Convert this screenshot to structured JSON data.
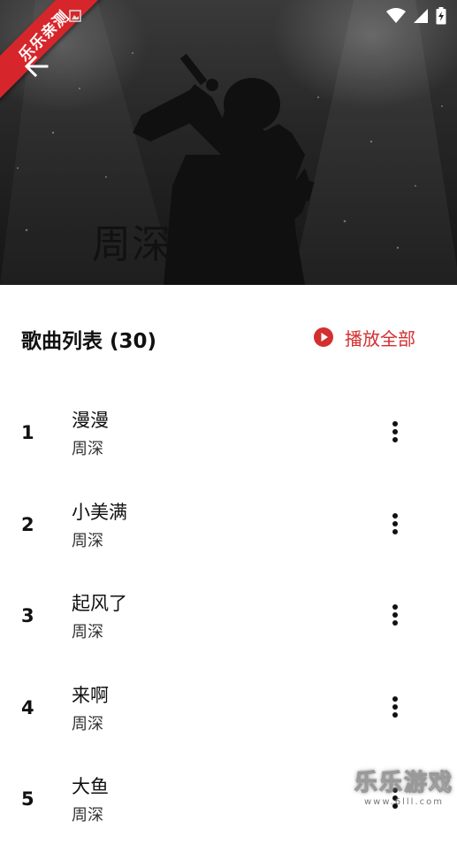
{
  "hero": {
    "artist_name": "周深",
    "ribbon_text": "乐乐亲测",
    "back_icon": "arrow-left-icon"
  },
  "status_bar": {
    "icons": [
      "wifi-icon",
      "signal-icon",
      "battery-charging-icon"
    ]
  },
  "song_list": {
    "title": "歌曲列表 (30)",
    "play_all_label": "播放全部",
    "play_all_icon": "play-circle-icon",
    "accent_color": "#d32f2f",
    "songs": [
      {
        "index": "1",
        "title": "漫漫",
        "artist": "周深"
      },
      {
        "index": "2",
        "title": "小美满",
        "artist": "周深"
      },
      {
        "index": "3",
        "title": "起风了",
        "artist": "周深"
      },
      {
        "index": "4",
        "title": "来啊",
        "artist": "周深"
      },
      {
        "index": "5",
        "title": "大鱼",
        "artist": "周深"
      }
    ]
  },
  "watermark": {
    "main": "乐乐游戏",
    "sub": "www.6lll.com"
  }
}
